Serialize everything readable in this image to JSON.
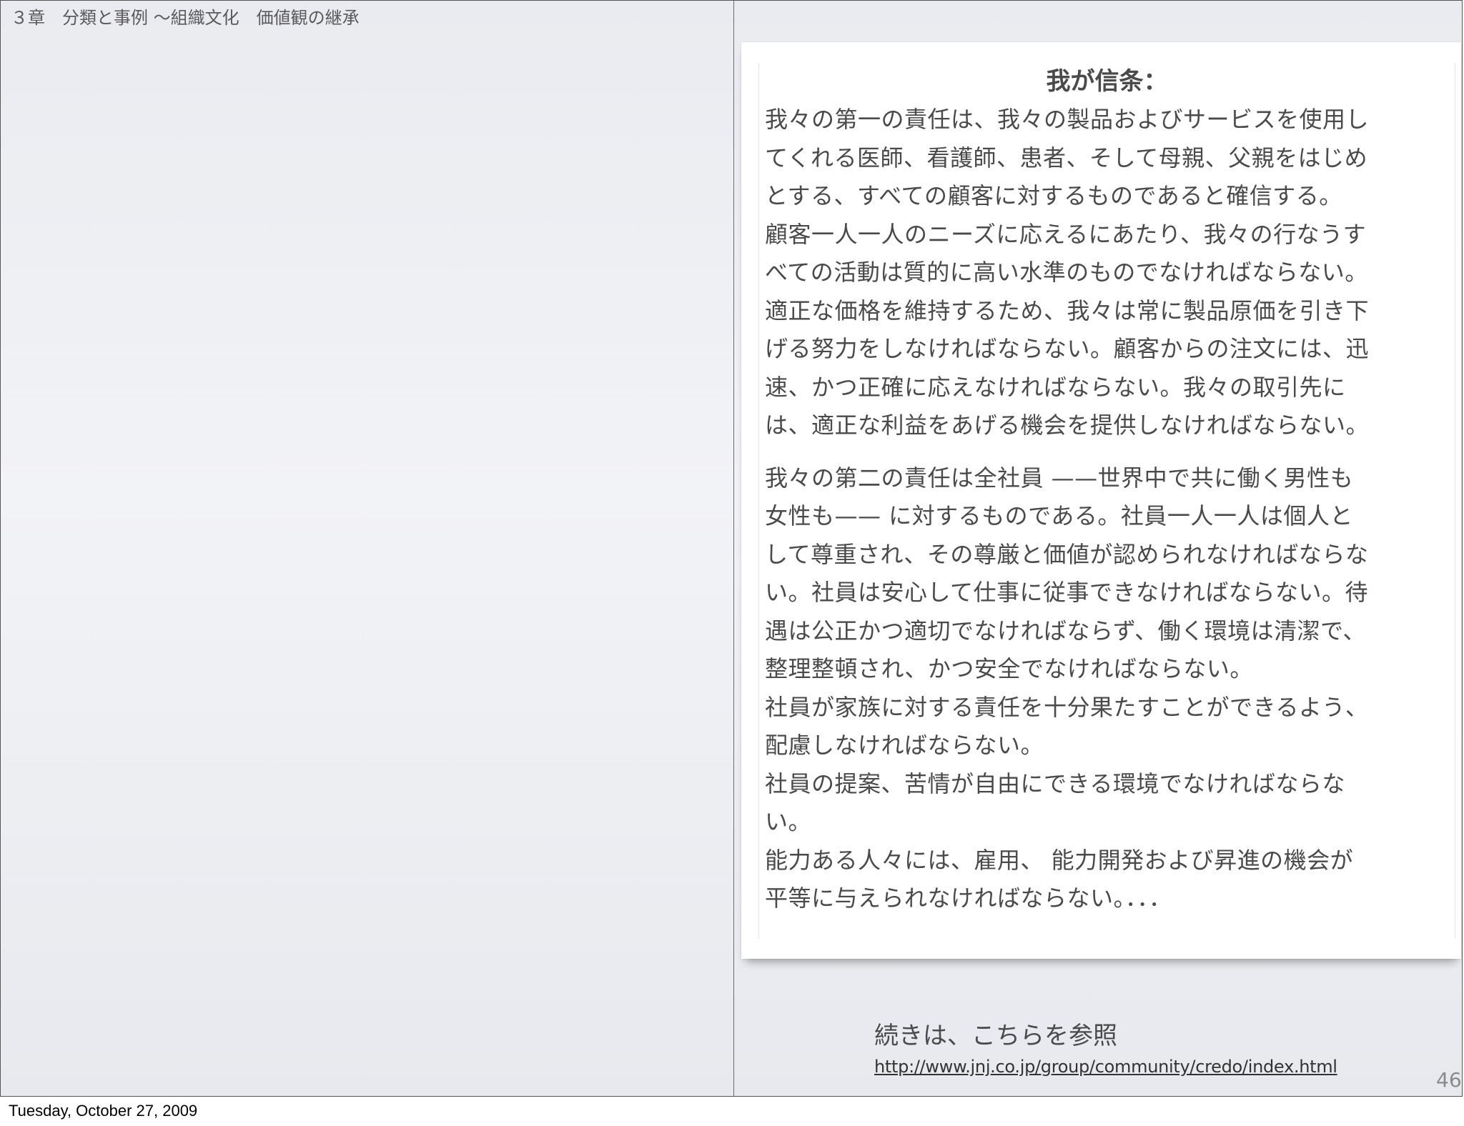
{
  "header": {
    "chapter_title": "３章　分類と事例 〜組織文化　価値観の継承"
  },
  "credo": {
    "heading": "我が信条：",
    "lines_block1": [
      "我々の第一の責任は、我々の製品およびサービスを使用し",
      "てくれる医師、看護師、患者、そして母親、父親をはじめ",
      "とする、すべての顧客に対するものであると確信する。",
      "顧客一人一人のニーズに応えるにあたり、我々の行なうす",
      "べての活動は質的に高い水準のものでなければならない。",
      "適正な価格を維持するため、我々は常に製品原価を引き下",
      "げる努力をしなければならない。顧客からの注文には、迅",
      "速、かつ正確に応えなければならない。我々の取引先に",
      "は、適正な利益をあげる機会を提供しなければならない。"
    ],
    "lines_block2": [
      "我々の第二の責任は全社員 ——世界中で共に働く男性も",
      "女性も—— に対するものである。社員一人一人は個人と",
      "して尊重され、その尊厳と価値が認められなければならな",
      "い。社員は安心して仕事に従事できなければならない。待",
      "遇は公正かつ適切でなければならず、働く環境は清潔で、",
      "整理整頓され、かつ安全でなければならない。",
      "社員が家族に対する責任を十分果たすことができるよう、",
      "配慮しなければならない。",
      "社員の提案、苦情が自由にできる環境でなければならな",
      "い。",
      "能力ある人々には、雇用、 能力開発および昇進の機会が",
      "平等に与えられなければならない。．．．"
    ]
  },
  "reference": {
    "text": "続きは、こちらを参照",
    "url": "http://www.jnj.co.jp/group/community/credo/index.html"
  },
  "page_number": "46",
  "footer": {
    "date": "Tuesday, October 27, 2009"
  }
}
